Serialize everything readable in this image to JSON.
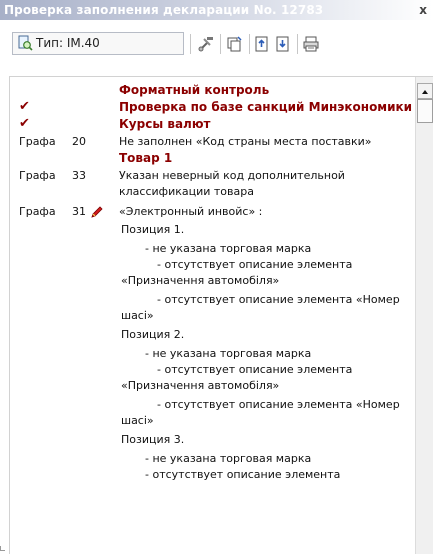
{
  "window": {
    "title": "Проверка заполнения декларации No. 12783",
    "close_label": "x"
  },
  "toolbar": {
    "type_label": "Тип: IM.40",
    "icons": [
      "search-doc-icon",
      "tools-icon",
      "copy-icon",
      "export-up-icon",
      "import-down-icon",
      "print-icon"
    ]
  },
  "colors": {
    "heading": "#8b0000",
    "text": "#111111",
    "title_gradient_start": "#a7b0c8"
  },
  "list": {
    "rows": [
      {
        "col1": "",
        "col2": "",
        "text": "Форматный контроль",
        "kind": "heading"
      },
      {
        "col1": "✔",
        "col2": "",
        "text": "Проверка по базе санкций Минэкономики",
        "kind": "heading"
      },
      {
        "col1": "✔",
        "col2": "",
        "text": "Курсы валют",
        "kind": "heading"
      },
      {
        "col1": "Графа",
        "col2": "20",
        "text": "Не заполнен «Код страны места поставки»",
        "kind": "normal"
      },
      {
        "col1": "",
        "col2": "",
        "text": "Товар 1",
        "kind": "heading"
      },
      {
        "col1": "Графа",
        "col2": "33",
        "text": "Указан неверный код дополнительной классификации товара",
        "kind": "normal"
      },
      {
        "col1": "Графа",
        "col2": "31",
        "text": "«Электронный инвойс» :",
        "kind": "pencil"
      },
      {
        "col1": "",
        "col2": "",
        "text": "Позиция 1.",
        "kind": "indent1"
      },
      {
        "col1": "",
        "col2": "",
        "text": "- не указана торговая марка",
        "kind": "indent2"
      },
      {
        "col1": "",
        "col2": "",
        "text": "- отсутствует описание элемента «Призначення автомобіля»",
        "kind": "hanging"
      },
      {
        "col1": "",
        "col2": "",
        "text": "- отсутствует описание элемента «Номер шасі»",
        "kind": "hanging"
      },
      {
        "col1": "",
        "col2": "",
        "text": "Позиция 2.",
        "kind": "indent1"
      },
      {
        "col1": "",
        "col2": "",
        "text": "- не указана торговая марка",
        "kind": "indent2"
      },
      {
        "col1": "",
        "col2": "",
        "text": "- отсутствует описание элемента «Призначення автомобіля»",
        "kind": "hanging"
      },
      {
        "col1": "",
        "col2": "",
        "text": "- отсутствует описание элемента «Номер шасі»",
        "kind": "hanging"
      },
      {
        "col1": "",
        "col2": "",
        "text": "Позиция 3.",
        "kind": "indent1"
      },
      {
        "col1": "",
        "col2": "",
        "text": "- не указана торговая марка",
        "kind": "indent2"
      },
      {
        "col1": "",
        "col2": "",
        "text": "- отсутствует описание элемента",
        "kind": "indent2"
      }
    ]
  }
}
